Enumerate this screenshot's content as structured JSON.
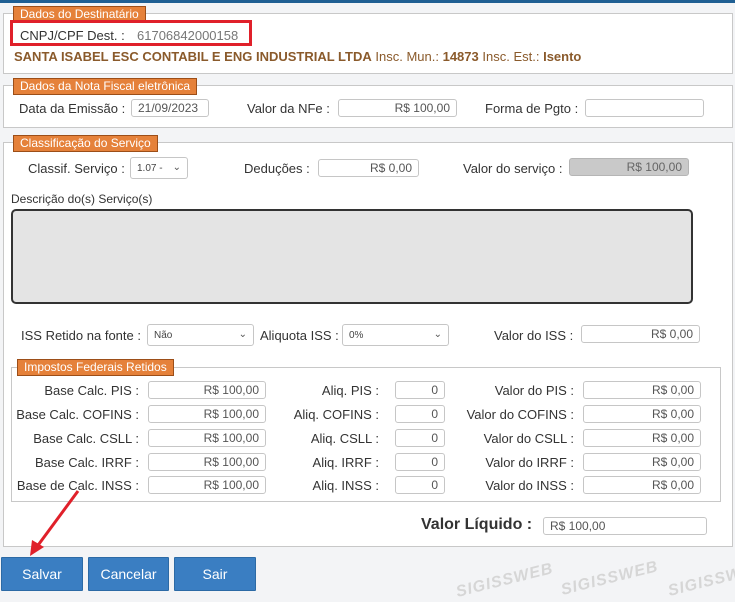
{
  "destinatario": {
    "legend": "Dados do Destinatário",
    "cnpj_label": "CNPJ/CPF Dest. :",
    "cnpj_value": "61706842000158",
    "company_name": "SANTA ISABEL ESC CONTABIL E ENG INDUSTRIAL LTDA",
    "insc_mun_label": "Insc. Mun.:",
    "insc_mun_value": "14873",
    "insc_est_label": "Insc. Est.:",
    "insc_est_value": "Isento"
  },
  "nota": {
    "legend": "Dados da Nota Fiscal eletrônica",
    "emissao_label": "Data da Emissão :",
    "emissao_value": "21/09/2023",
    "valor_label": "Valor da NFe :",
    "valor_value": "R$ 100,00",
    "pgto_label": "Forma de Pgto :",
    "pgto_value": ""
  },
  "classificacao": {
    "legend": "Classificação do Serviço",
    "classif_label": "Classif. Serviço :",
    "classif_value": "1.07 -",
    "deducoes_label": "Deduções :",
    "deducoes_value": "R$ 0,00",
    "valor_servico_label": "Valor do serviço :",
    "valor_servico_value": "R$ 100,00"
  },
  "descricao": {
    "label": "Descrição do(s) Serviço(s)",
    "value": ""
  },
  "iss": {
    "retido_label": "ISS Retido na fonte :",
    "retido_value": "Não",
    "aliquota_label": "Aliquota ISS :",
    "aliquota_value": "0%",
    "valor_label": "Valor do ISS :",
    "valor_value": "R$ 0,00"
  },
  "federais": {
    "legend": "Impostos Federais Retidos",
    "rows": [
      {
        "base_label": "Base Calc. PIS :",
        "base_value": "R$ 100,00",
        "aliq_label": "Aliq. PIS :",
        "aliq_value": "0",
        "valor_label": "Valor do PIS :",
        "valor_value": "R$ 0,00"
      },
      {
        "base_label": "Base Calc. COFINS :",
        "base_value": "R$ 100,00",
        "aliq_label": "Aliq. COFINS :",
        "aliq_value": "0",
        "valor_label": "Valor do COFINS :",
        "valor_value": "R$ 0,00"
      },
      {
        "base_label": "Base Calc. CSLL :",
        "base_value": "R$ 100,00",
        "aliq_label": "Aliq. CSLL :",
        "aliq_value": "0",
        "valor_label": "Valor do CSLL :",
        "valor_value": "R$ 0,00"
      },
      {
        "base_label": "Base Calc. IRRF :",
        "base_value": "R$ 100,00",
        "aliq_label": "Aliq. IRRF :",
        "aliq_value": "0",
        "valor_label": "Valor do IRRF :",
        "valor_value": "R$ 0,00"
      },
      {
        "base_label": "Base de Calc. INSS :",
        "base_value": "R$ 100,00",
        "aliq_label": "Aliq. INSS :",
        "aliq_value": "0",
        "valor_label": "Valor do INSS :",
        "valor_value": "R$ 0,00"
      }
    ]
  },
  "liquido": {
    "label": "Valor Líquido :",
    "value": "R$ 100,00"
  },
  "buttons": {
    "salvar": "Salvar",
    "cancelar": "Cancelar",
    "sair": "Sair"
  },
  "watermark": "SIGISSWEB",
  "colors": {
    "legend_bg": "#e5813a",
    "button_bg": "#3a7ec2",
    "highlight": "#e0202a",
    "arrow": "#e0202a"
  }
}
